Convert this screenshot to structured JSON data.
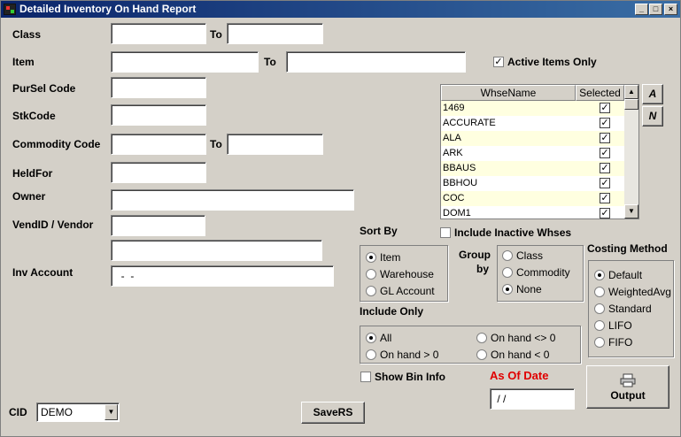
{
  "window": {
    "title": "Detailed Inventory On Hand Report",
    "minimize": "_",
    "maximize": "□",
    "close": "×"
  },
  "labels": {
    "class": "Class",
    "to": "To",
    "item": "Item",
    "pursel_code": "PurSel Code",
    "stkcode": "StkCode",
    "commodity_code": "Commodity Code",
    "heldfor": "HeldFor",
    "owner": "Owner",
    "vendor": "VendID / Vendor",
    "inv_account": "Inv Account",
    "cid": "CID",
    "sort_by": "Sort By",
    "group_by_1": "Group",
    "group_by_2": "by",
    "costing_method": "Costing Method",
    "include_only": "Include Only",
    "as_of_date": "As Of Date"
  },
  "fields": {
    "class_from": "",
    "class_to": "",
    "item_from": "",
    "item_to": "",
    "pursel_code": "",
    "stkcode": "",
    "commodity_from": "",
    "commodity_to": "",
    "heldfor": "",
    "owner": "",
    "vendor_id": "",
    "vendor_name": "",
    "inv_account": "  -  -",
    "as_of_date": " / /",
    "cid": "DEMO"
  },
  "checkboxes": {
    "active_items_only": "Active Items Only",
    "include_inactive_whses": "Include Inactive Whses",
    "show_bin_info": "Show Bin Info"
  },
  "warehouse_grid": {
    "col_name": "WhseName",
    "col_selected": "Selected",
    "rows": [
      "1469",
      "ACCURATE",
      "ALA",
      "ARK",
      "BBAUS",
      "BBHOU",
      "COC",
      "DOM1"
    ],
    "check": "✓"
  },
  "side_buttons": {
    "all": "A",
    "none": "N"
  },
  "sort_by": [
    "Item",
    "Warehouse",
    "GL Account"
  ],
  "group_by": [
    "Class",
    "Commodity",
    "None"
  ],
  "costing": [
    "Default",
    "WeightedAvg",
    "Standard",
    "LIFO",
    "FIFO"
  ],
  "include_only": [
    "All",
    "On hand > 0",
    "On hand <> 0",
    "On hand < 0"
  ],
  "buttons": {
    "save_rs": "SaveRS",
    "output": "Output"
  },
  "colors": {
    "as_of_date": "#e00000",
    "row_alt": "#ffffe0"
  }
}
